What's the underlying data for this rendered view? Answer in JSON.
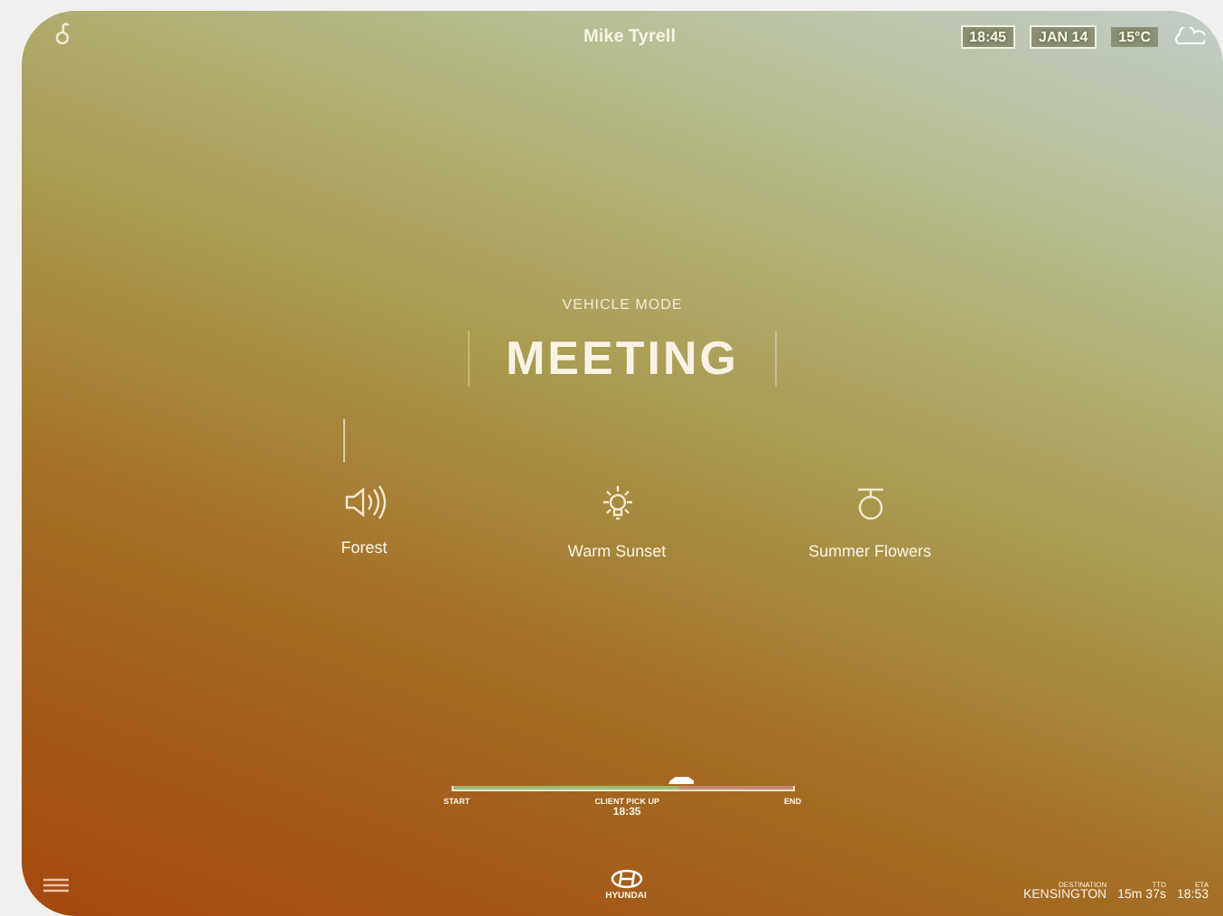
{
  "top_bar": {
    "driver": "Mike Tyrell",
    "time": "18:45",
    "date": "JAN 14",
    "temperature": "15°C"
  },
  "mode": {
    "caption": "VEHICLE MODE",
    "name": "MEETING"
  },
  "ambience": [
    {
      "kind": "sound",
      "label": "Forest"
    },
    {
      "kind": "light",
      "label": "Warm Sunset"
    },
    {
      "kind": "scent",
      "label": "Summer Flowers"
    }
  ],
  "trip": {
    "start": "START",
    "stop": "CLIENT PICK UP",
    "stop_time": "18:35",
    "end": "END",
    "level": 0.67
  },
  "brand": "HYUNDAI",
  "destination": {
    "caption": "DESTINATION",
    "name": "KENSINGTON",
    "ttd_caption": "TTD",
    "ttd": "15m 37s",
    "eta_caption": "ETA",
    "eta": "18:53"
  }
}
